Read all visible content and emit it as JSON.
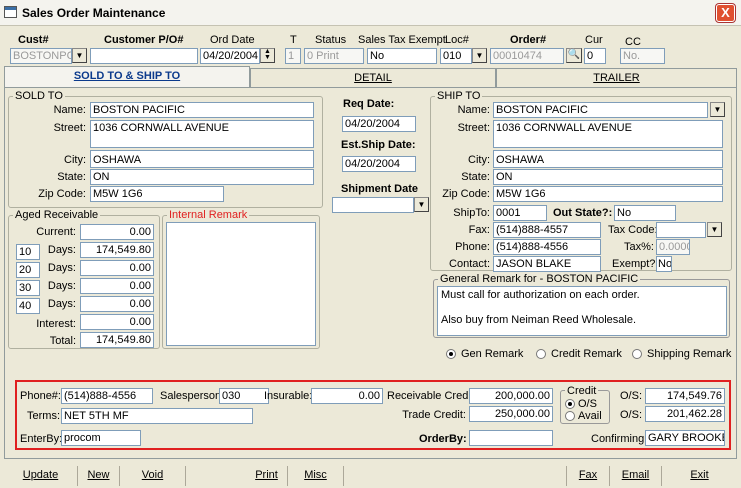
{
  "window": {
    "title": "Sales Order Maintenance",
    "close_label": "X"
  },
  "header": {
    "cust_label": "Cust#",
    "cust_value": "BOSTONPC",
    "po_label": "Customer P/O#",
    "po_value": "",
    "ord_date_label": "Ord Date",
    "ord_date_value": "04/20/2004",
    "t_label": "T",
    "t_value": "1",
    "status_label": "Status",
    "status_value": "0 Print",
    "tax_exempt_label": "Sales Tax Exempt",
    "tax_exempt_value": "No",
    "loc_label": "Loc#",
    "loc_value": "010",
    "order_label": "Order#",
    "order_value": "00010474",
    "cur_label": "Cur",
    "cur_value": "0",
    "cc_label": "CC",
    "cc_value": "No."
  },
  "tabs": {
    "sold_ship": "SOLD TO & SHIP TO",
    "detail": "DETAIL",
    "trailer": "TRAILER"
  },
  "sold_to": {
    "group": "SOLD TO",
    "name_label": "Name:",
    "name": "BOSTON PACIFIC",
    "street_label": "Street:",
    "street": "1036 CORNWALL AVENUE",
    "city_label": "City:",
    "city": "OSHAWA",
    "state_label": "State:",
    "state": "ON",
    "zip_label": "Zip Code:",
    "zip": "M5W 1G6"
  },
  "dates": {
    "req_label": "Req Date:",
    "req": "04/20/2004",
    "est_label": "Est.Ship Date:",
    "est": "04/20/2004",
    "ship_label": "Shipment Date",
    "ship": ""
  },
  "ship_to": {
    "group": "SHIP TO",
    "name_label": "Name:",
    "name": "BOSTON PACIFIC",
    "street_label": "Street:",
    "street": "1036 CORNWALL AVENUE",
    "city_label": "City:",
    "city": "OSHAWA",
    "state_label": "State:",
    "state": "ON",
    "zip_label": "Zip Code:",
    "zip": "M5W 1G6",
    "shipto_label": "ShipTo:",
    "shipto": "0001",
    "outstate_label": "Out State?:",
    "outstate": "No",
    "fax_label": "Fax:",
    "fax": "(514)888-4557",
    "taxcode_label": "Tax Code:",
    "taxcode": "",
    "phone_label": "Phone:",
    "phone": "(514)888-4556",
    "taxpct_label": "Tax%:",
    "taxpct": "0.0000",
    "contact_label": "Contact:",
    "contact": "JASON BLAKE",
    "exempt_label": "Exempt?:",
    "exempt": "No"
  },
  "aged": {
    "group": "Aged Receivable",
    "current_label": "Current:",
    "current": "0.00",
    "rows": [
      {
        "days": "10",
        "label": "Days:",
        "amount": "174,549.80"
      },
      {
        "days": "20",
        "label": "Days:",
        "amount": "0.00"
      },
      {
        "days": "30",
        "label": "Days:",
        "amount": "0.00"
      },
      {
        "days": "40",
        "label": "Days:",
        "amount": "0.00"
      }
    ],
    "interest_label": "Interest:",
    "interest": "0.00",
    "total_label": "Total:",
    "total": "174,549.80"
  },
  "internal_remark": {
    "group": "Internal Remark"
  },
  "general_remark": {
    "group": "General Remark for - BOSTON PACIFIC",
    "line1": "Must call for authorization on each order.",
    "line2": "Also buy from Neiman Reed Wholesale."
  },
  "remark_radios": {
    "gen": "Gen Remark",
    "credit": "Credit Remark",
    "shipping": "Shipping Remark"
  },
  "bottom": {
    "phone_label": "Phone#:",
    "phone": "(514)888-4556",
    "salesperson_label": "Salesperson:",
    "salesperson": "030",
    "insurable_label": "Insurable:",
    "insurable": "0.00",
    "recv_credit_label": "Receivable Credit:",
    "recv_credit": "200,000.00",
    "trade_credit_label": "Trade Credit:",
    "trade_credit": "250,000.00",
    "credit_group": "Credit",
    "os_radio": "O/S",
    "avail_radio": "Avail",
    "os1_label": "O/S:",
    "os1": "174,549.76",
    "os2_label": "O/S:",
    "os2": "201,462.28",
    "terms_label": "Terms:",
    "terms": "NET 5TH MF",
    "enterby_label": "EnterBy:",
    "enterby": "procom",
    "orderby_label": "OrderBy:",
    "orderby": "",
    "confirming_label": "Confirming:",
    "confirming": "GARY BROOKE"
  },
  "buttons": {
    "update": "Update",
    "new": "New",
    "void": "Void",
    "print": "Print",
    "misc": "Misc",
    "fax": "Fax",
    "email": "Email",
    "exit": "Exit"
  }
}
